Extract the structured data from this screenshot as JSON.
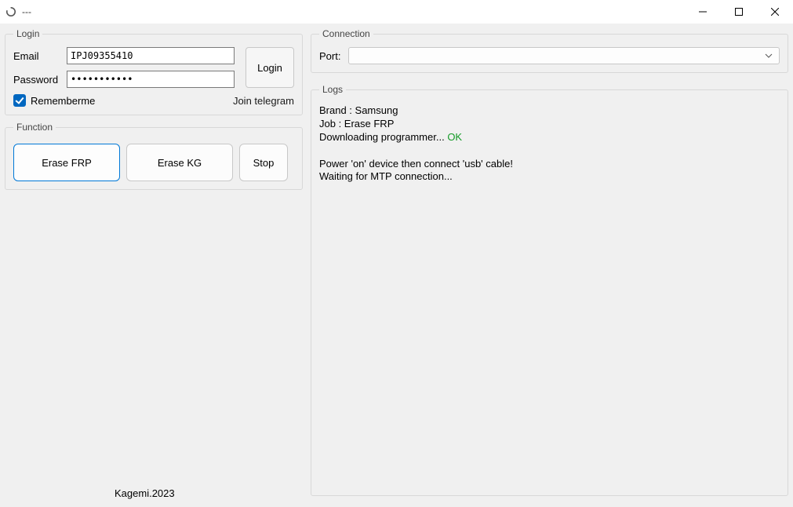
{
  "window": {
    "title": "---"
  },
  "login": {
    "legend": "Login",
    "email_label": "Email",
    "email_value": "IPJ09355410",
    "password_label": "Password",
    "password_value": "•••••••••••",
    "login_button": "Login",
    "remember_label": "Rememberme",
    "remember_checked": true,
    "telegram_link": "Join telegram"
  },
  "function": {
    "legend": "Function",
    "erase_frp": "Erase FRP",
    "erase_kg": "Erase KG",
    "stop": "Stop"
  },
  "connection": {
    "legend": "Connection",
    "port_label": "Port:",
    "port_value": ""
  },
  "logs": {
    "legend": "Logs",
    "lines": [
      {
        "text": "Brand : Samsung"
      },
      {
        "text": "Job : Erase FRP"
      },
      {
        "text": "Downloading programmer... ",
        "suffix": "OK",
        "suffix_class": "ok"
      },
      {
        "text": ""
      },
      {
        "text": "Power 'on' device then connect 'usb' cable!"
      },
      {
        "text": "Waiting for MTP connection..."
      }
    ]
  },
  "footer": {
    "text": "Kagemi.2023"
  }
}
